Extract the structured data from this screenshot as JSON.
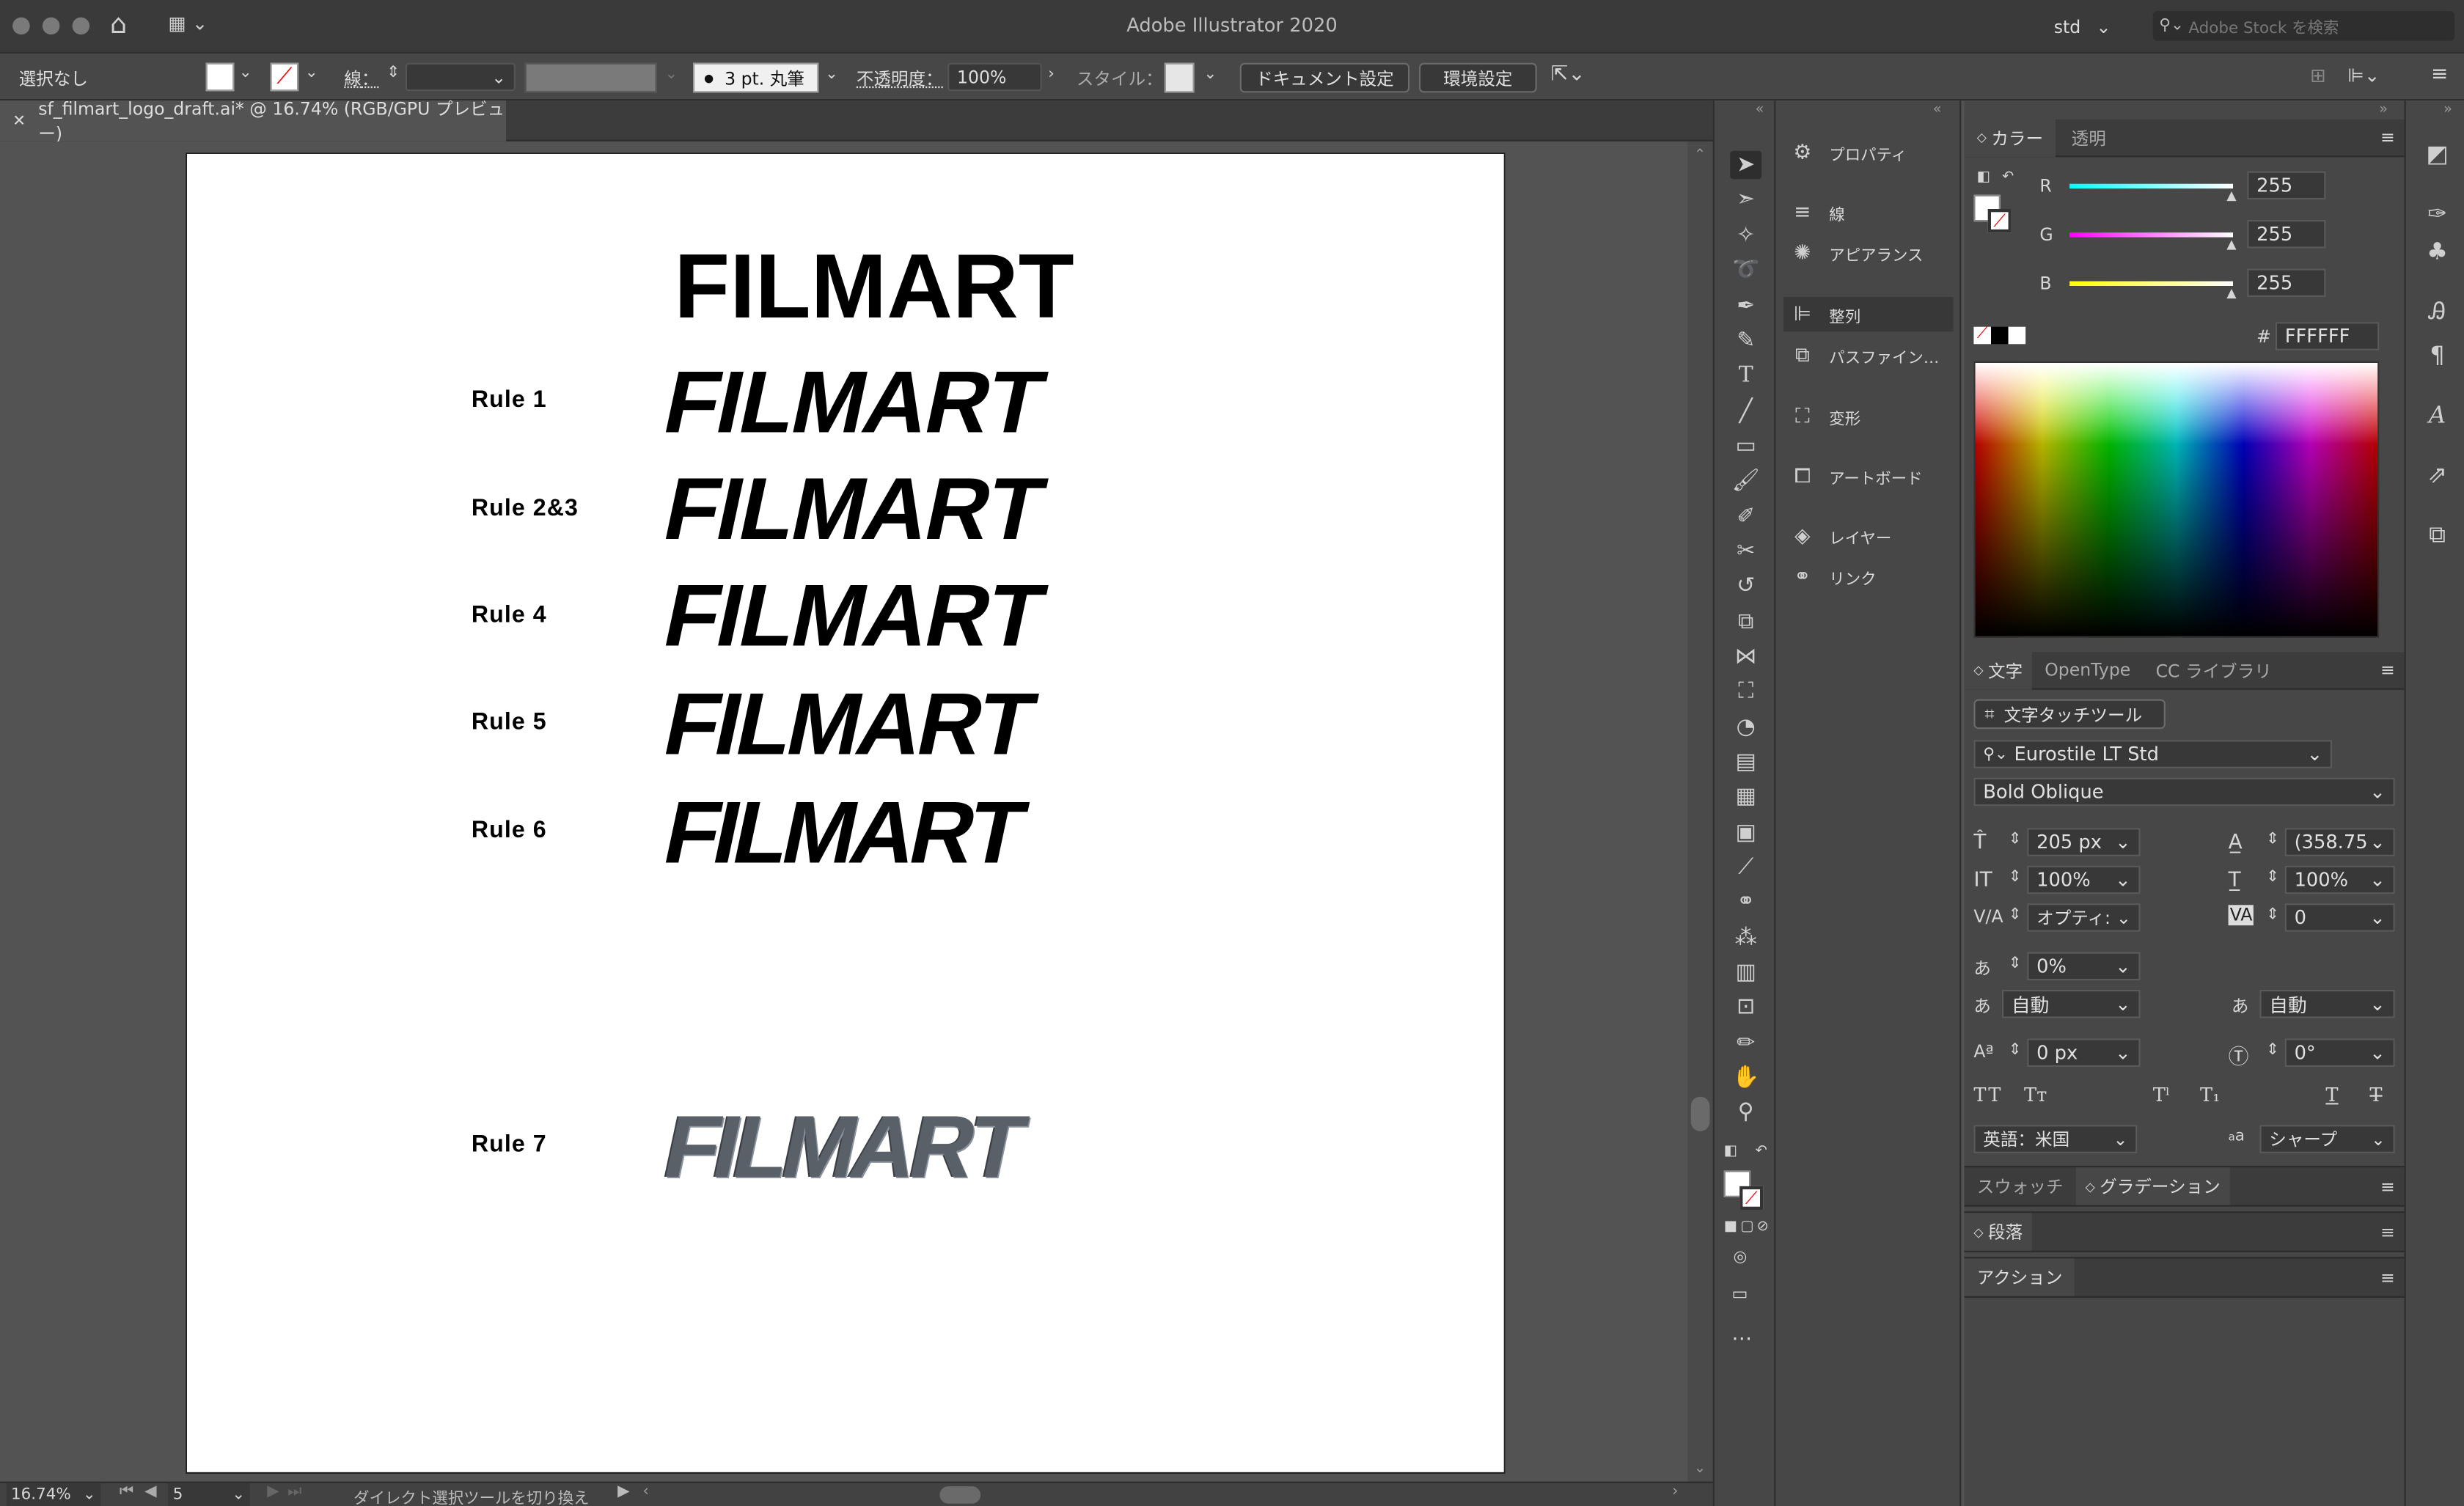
{
  "app": {
    "title": "Adobe Illustrator 2020",
    "workspace": "std",
    "stock_placeholder": "Adobe Stock を検索"
  },
  "control": {
    "selection": "選択なし",
    "stroke_label": "線",
    "brush": "3 pt. 丸筆",
    "opacity_label": "不透明度",
    "opacity": "100%",
    "style_label": "スタイル",
    "doc_settings": "ドキュメント設定",
    "prefs": "環境設定"
  },
  "document": {
    "tab": "sf_filmart_logo_draft.ai* @ 16.74% (RGB/GPU プレビュー)"
  },
  "artboard": {
    "logos": [
      {
        "rule": "",
        "text": "FILMART"
      },
      {
        "rule": "Rule 1",
        "text": "FILMART"
      },
      {
        "rule": "Rule 2&3",
        "text": "FILMART"
      },
      {
        "rule": "Rule 4",
        "text": "FILMART"
      },
      {
        "rule": "Rule 5",
        "text": "FILMART"
      },
      {
        "rule": "Rule 6",
        "text": "FILMART"
      },
      {
        "rule": "Rule 7",
        "text": "FILMART"
      }
    ]
  },
  "status": {
    "zoom": "16.74%",
    "artboard_num": "5",
    "message": "ダイレクト選択ツールを切り換え"
  },
  "mid_panel": {
    "items": [
      "プロパティ",
      "線",
      "アピアランス",
      "整列",
      "パスファイン…",
      "変形",
      "アートボード",
      "レイヤー",
      "リンク"
    ]
  },
  "color_panel": {
    "tabs": [
      "カラー",
      "透明"
    ],
    "r_label": "R",
    "g_label": "G",
    "b_label": "B",
    "r": "255",
    "g": "255",
    "b": "255",
    "hex_label": "#",
    "hex": "FFFFFF"
  },
  "char_panel": {
    "tabs": [
      "文字",
      "OpenType",
      "CC ライブラリ"
    ],
    "touch_tool": "文字タッチツール",
    "font": "Eurostile LT Std",
    "style": "Bold Oblique",
    "size": "205 px",
    "leading": "(358.75",
    "vscale": "100%",
    "hscale": "100%",
    "kerning": "オプティ:",
    "tracking": "0",
    "tsume": "0%",
    "aki_left": "自動",
    "aki_right": "自動",
    "baseline": "0 px",
    "rotation": "0°",
    "language": "英語：米国",
    "aa_label": "a",
    "aa": "シャープ"
  },
  "lower_panels": {
    "swatch": "スウォッチ",
    "gradient": "グラデーション",
    "paragraph": "段落",
    "action": "アクション"
  },
  "colors": {
    "accent_hex": "#FFFFFF"
  }
}
